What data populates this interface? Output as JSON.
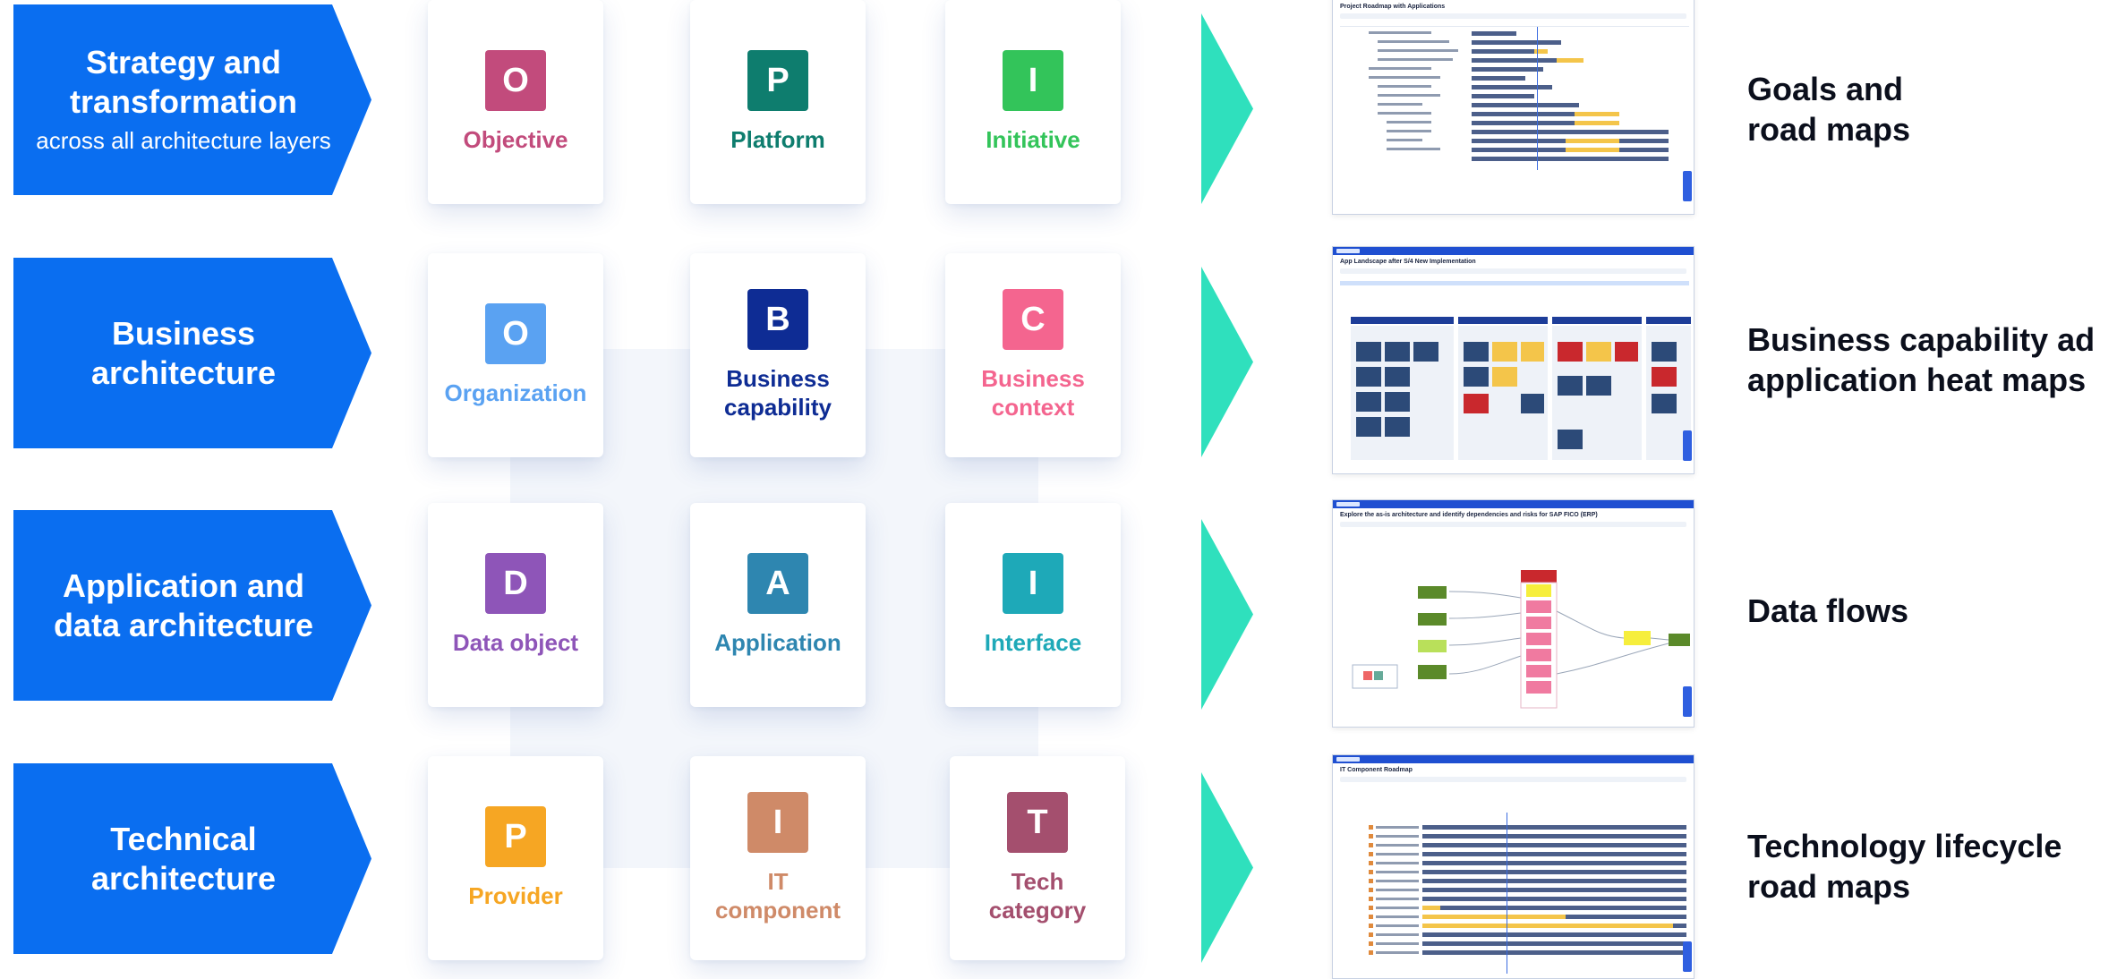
{
  "rows": [
    {
      "chevron": {
        "title": "Strategy and\ntransformation",
        "subtitle": "across all architecture layers"
      },
      "cards": [
        {
          "letter": "O",
          "label": "Objective",
          "color": "#c24b7c"
        },
        {
          "letter": "P",
          "label": "Platform",
          "color": "#0e7d6e"
        },
        {
          "letter": "I",
          "label": "Initiative",
          "color": "#33c45a"
        }
      ],
      "screenshot": {
        "title": "Project Roadmap with Applications"
      },
      "outcome": "Goals and\nroad maps"
    },
    {
      "chevron": {
        "title": "Business\narchitecture",
        "subtitle": ""
      },
      "cards": [
        {
          "letter": "O",
          "label": "Organization",
          "color": "#5aa2f2"
        },
        {
          "letter": "B",
          "label": "Business\ncapability",
          "color": "#0e2c94"
        },
        {
          "letter": "C",
          "label": "Business\ncontext",
          "color": "#f4658f"
        }
      ],
      "screenshot": {
        "title": "App Landscape after S/4 New Implementation"
      },
      "outcome": "Business capability ad\napplication heat maps"
    },
    {
      "chevron": {
        "title": "Application and\ndata architecture",
        "subtitle": ""
      },
      "cards": [
        {
          "letter": "D",
          "label": "Data object",
          "color": "#8e55b8"
        },
        {
          "letter": "A",
          "label": "Application",
          "color": "#2e86b0"
        },
        {
          "letter": "I",
          "label": "Interface",
          "color": "#1ea9b8"
        }
      ],
      "screenshot": {
        "title": "Explore the as-is architecture and identify dependencies and risks for SAP FICO (ERP)"
      },
      "outcome": "Data flows"
    },
    {
      "chevron": {
        "title": "Technical\narchitecture",
        "subtitle": ""
      },
      "cards": [
        {
          "letter": "P",
          "label": "Provider",
          "color": "#f6a623"
        },
        {
          "letter": "I",
          "label": "IT\ncomponent",
          "color": "#cf8a68"
        },
        {
          "letter": "T",
          "label": "Tech\ncategory",
          "color": "#a44f6e"
        }
      ],
      "screenshot": {
        "title": "IT Component Roadmap"
      },
      "outcome": "Technology lifecycle\nroad maps"
    }
  ]
}
